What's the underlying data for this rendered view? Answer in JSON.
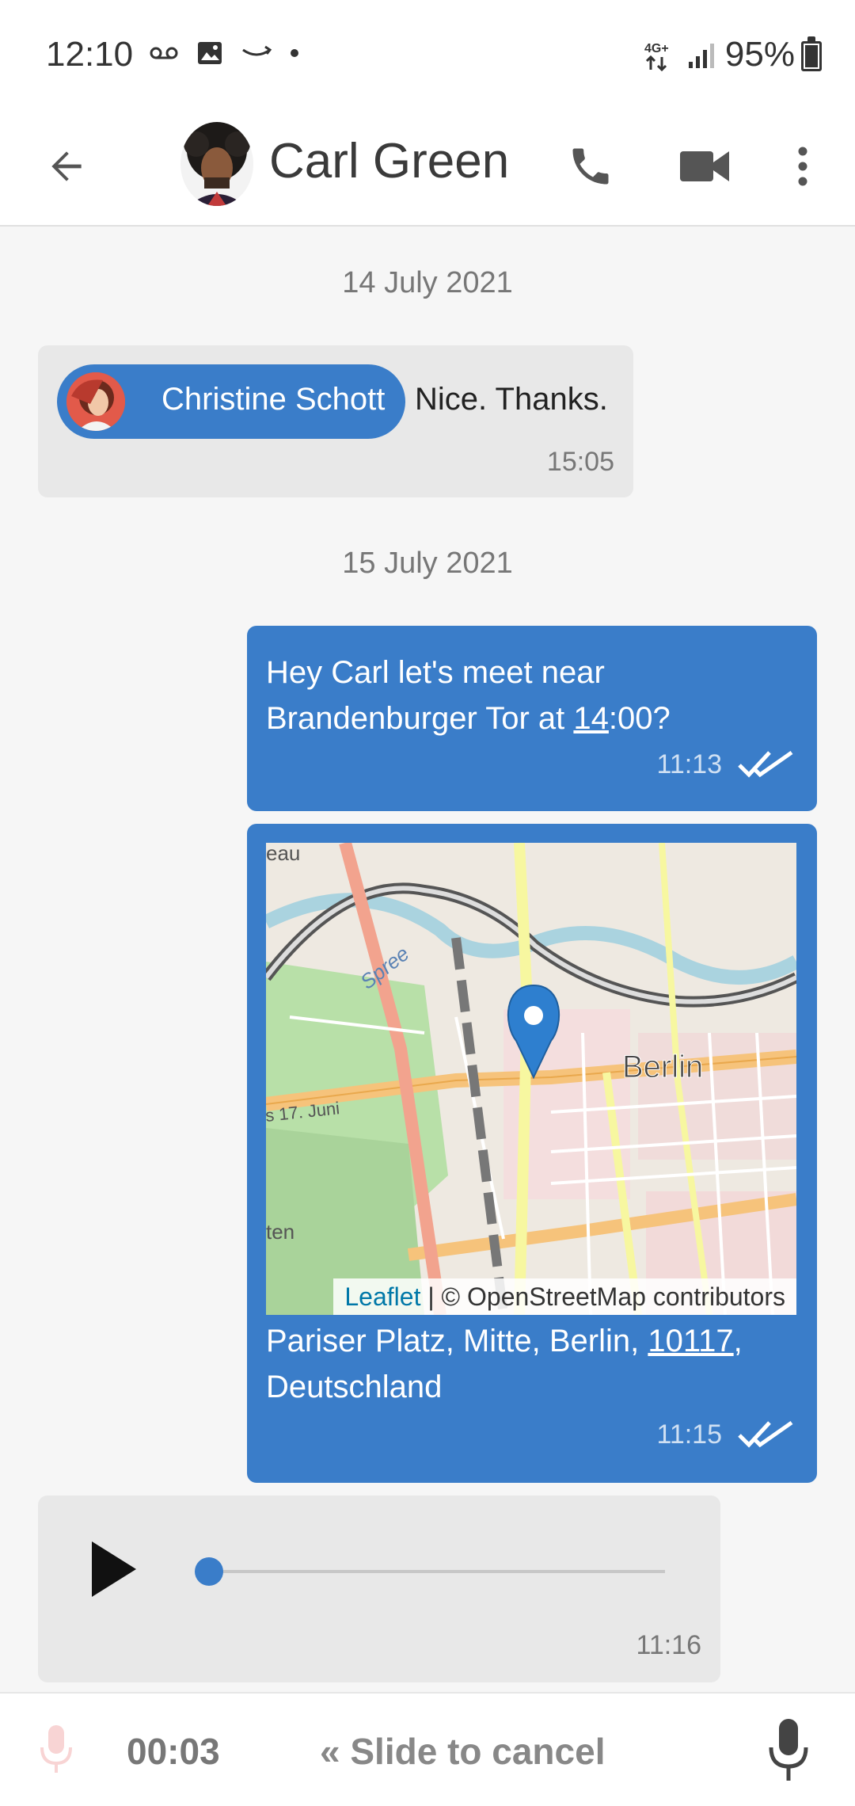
{
  "status_bar": {
    "time": "12:10",
    "battery": "95%",
    "network": "4G+"
  },
  "header": {
    "contact_name": "Carl Green"
  },
  "messages": {
    "day1": "14 July 2021",
    "incoming1": {
      "mention": "Christine Schott",
      "text": "Nice. Thanks.",
      "time": "15:05"
    },
    "day2": "15 July 2021",
    "outgoing1": {
      "text_before": "Hey Carl let's meet near Brandenburger Tor at ",
      "text_link": "14",
      "text_after": ":00?",
      "time": "11:13"
    },
    "outgoing2": {
      "map_attribution_link": "Leaflet",
      "map_attribution_text": " | © OpenStreetMap contributors",
      "map_label_city": "Berlin",
      "map_label_river": "Spree",
      "map_label_street": "s 17. Juni",
      "map_label_edge1": "eau",
      "map_label_edge2": "ten",
      "address_before": "Pariser Platz, Mitte, Berlin, ",
      "address_link": "10117",
      "address_after": ", Deutschland",
      "time": "11:15"
    },
    "voice": {
      "time": "11:16",
      "progress": 0
    }
  },
  "recorder": {
    "elapsed": "00:03",
    "slide_text": "« Slide to cancel"
  },
  "colors": {
    "accent": "#3a7dc9",
    "bubble_in": "#e8e8e8"
  }
}
